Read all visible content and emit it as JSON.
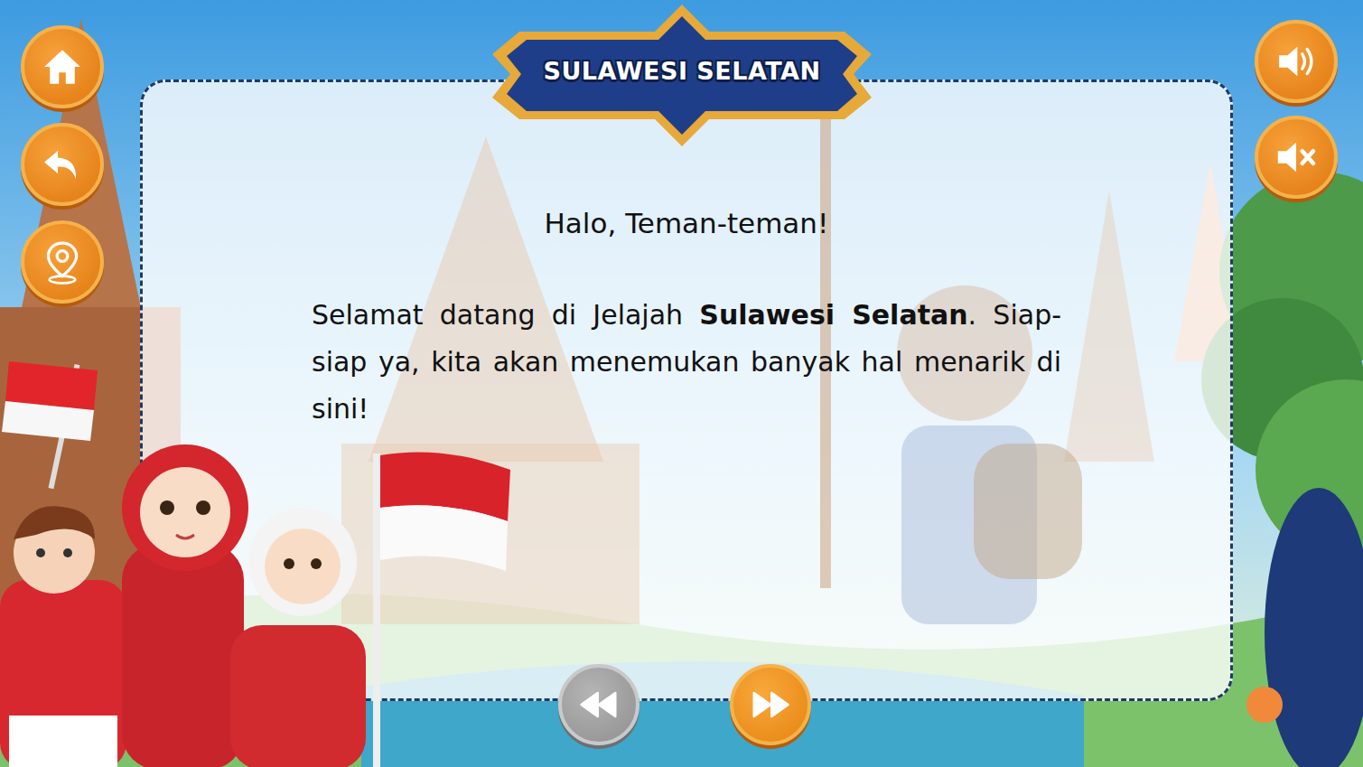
{
  "title": "SULAWESI SELATAN",
  "greeting": "Halo, Teman-teman!",
  "paragraph": [
    {
      "text": "Selamat datang di Jelajah ",
      "bold": false
    },
    {
      "text": "Sulawesi Selatan",
      "bold": true
    },
    {
      "text": ". Siap-siap ya, kita akan menemukan banyak hal menarik di sini!",
      "bold": false
    }
  ],
  "nav": {
    "previous": {
      "disabled": true
    },
    "next": {
      "disabled": false
    }
  }
}
